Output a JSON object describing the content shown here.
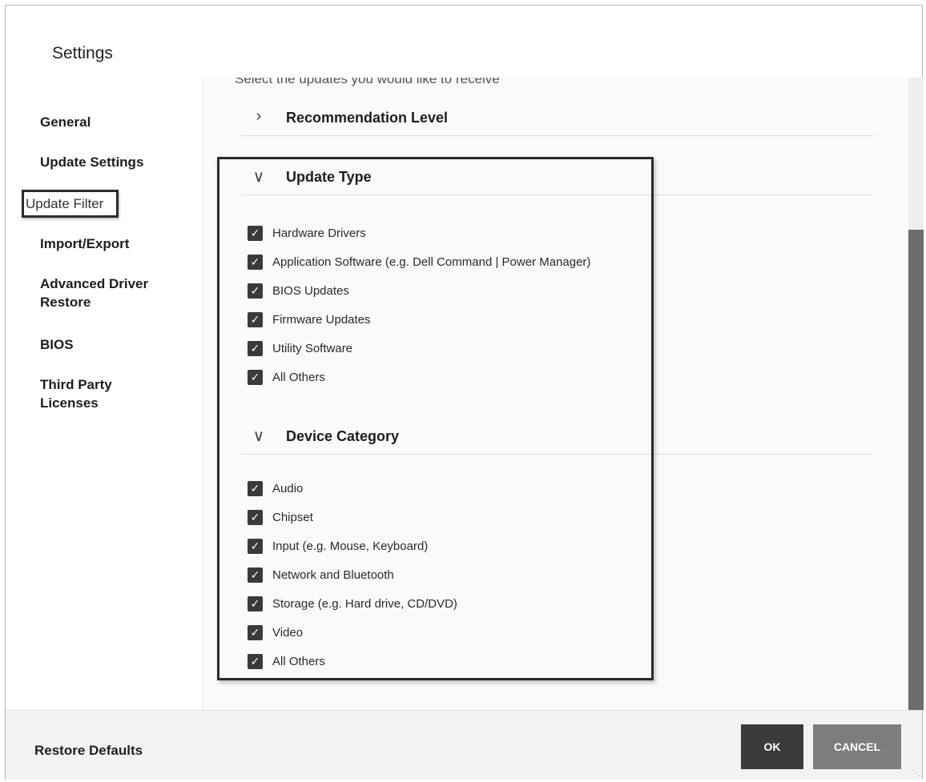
{
  "window": {
    "title": "Settings"
  },
  "sidebar": {
    "items": [
      {
        "label": "General"
      },
      {
        "label": "Update Settings"
      },
      {
        "label": "Update Filter"
      },
      {
        "label": "Import/Export"
      },
      {
        "label": "Advanced Driver Restore"
      },
      {
        "label": "BIOS"
      },
      {
        "label": "Third Party Licenses"
      }
    ]
  },
  "content": {
    "intro_text": "Select the updates you would like to receive",
    "recommendation_level": {
      "title": "Recommendation Level",
      "expanded": false
    },
    "update_type": {
      "title": "Update Type",
      "expanded": true,
      "options": [
        {
          "label": "Hardware Drivers",
          "checked": true
        },
        {
          "label": "Application Software (e.g. Dell Command | Power Manager)",
          "checked": true
        },
        {
          "label": "BIOS Updates",
          "checked": true
        },
        {
          "label": "Firmware Updates",
          "checked": true
        },
        {
          "label": "Utility Software",
          "checked": true
        },
        {
          "label": "All Others",
          "checked": true
        }
      ]
    },
    "device_category": {
      "title": "Device Category",
      "expanded": true,
      "options": [
        {
          "label": "Audio",
          "checked": true
        },
        {
          "label": "Chipset",
          "checked": true
        },
        {
          "label": "Input (e.g. Mouse, Keyboard)",
          "checked": true
        },
        {
          "label": "Network and Bluetooth",
          "checked": true
        },
        {
          "label": "Storage (e.g. Hard drive, CD/DVD)",
          "checked": true
        },
        {
          "label": "Video",
          "checked": true
        },
        {
          "label": "All Others",
          "checked": true
        }
      ]
    }
  },
  "footer": {
    "restore_label": "Restore Defaults",
    "ok_label": "OK",
    "cancel_label": "CANCEL"
  },
  "icons": {
    "collapsed": "chevron-right-icon",
    "expanded": "chevron-down-icon",
    "checkbox": "checkmark-icon"
  },
  "colors": {
    "checkbox_fill": "#3a3a3a",
    "ok_button": "#3b3b3b",
    "cancel_button": "#7d7d7d"
  }
}
